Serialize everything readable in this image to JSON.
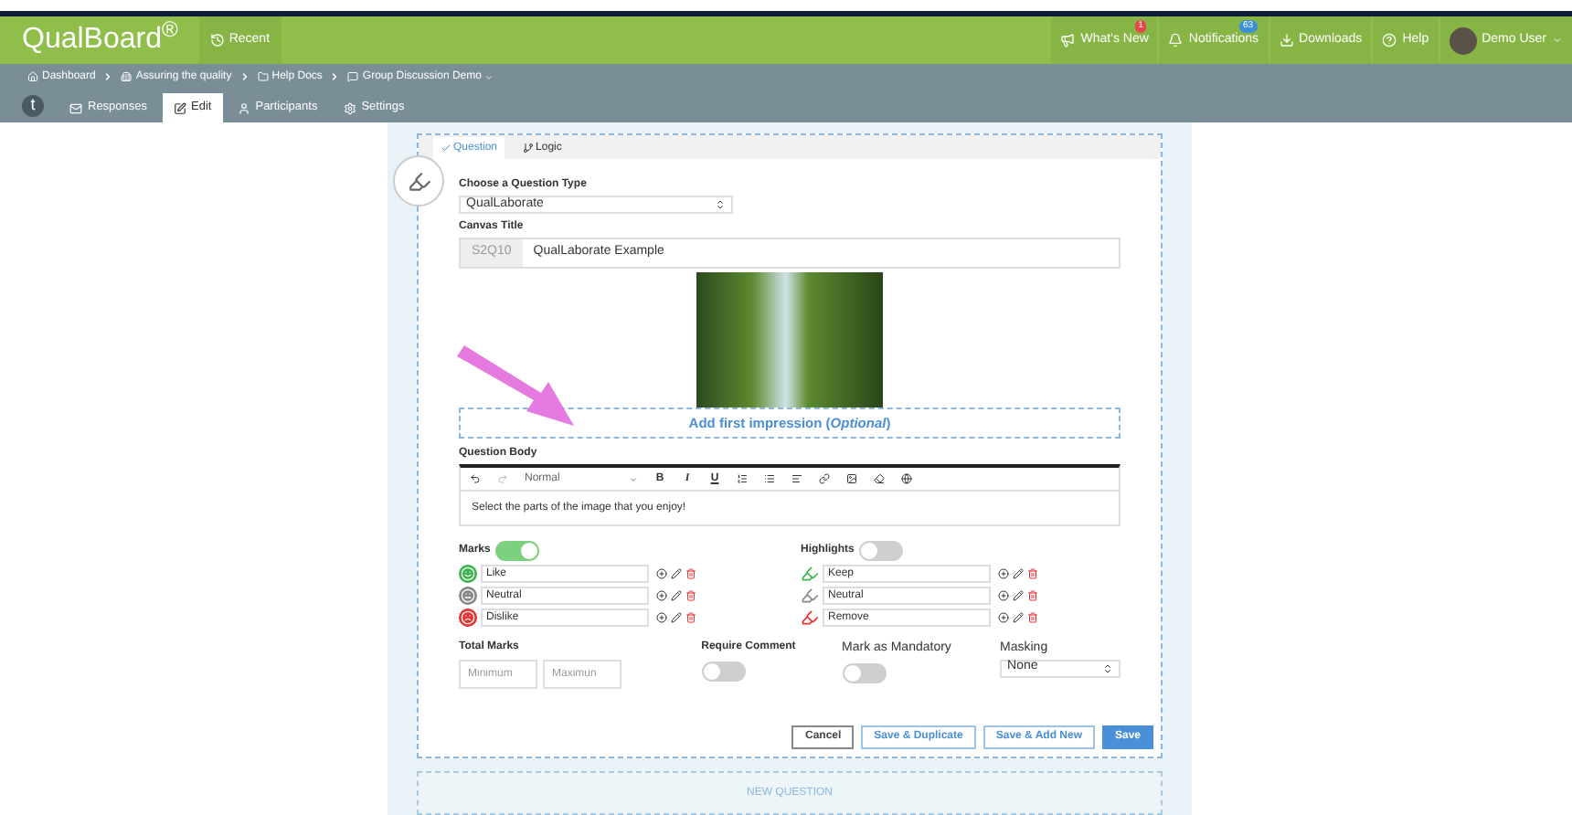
{
  "header": {
    "logo": "QualBoard$^{®}$",
    "recent": "Recent",
    "nav": [
      {
        "kind": "megaphone",
        "label": "What's New",
        "badge": "1",
        "color": "#e8474a"
      },
      {
        "kind": "bell",
        "label": "Notifications",
        "badge": "63",
        "color": "#3a8fd6"
      },
      {
        "kind": "download",
        "label": "Downloads"
      },
      {
        "kind": "help",
        "label": "Help"
      }
    ],
    "user": "Demo User"
  },
  "breadcrumbs": [
    {
      "kind": "home",
      "label": "Dashboard"
    },
    {
      "kind": "building",
      "label": "Assuring the quality"
    },
    {
      "kind": "folder",
      "label": "Help Docs"
    },
    {
      "kind": "chat",
      "label": "Group Discussion Demo"
    }
  ],
  "app_badge": "t",
  "tabs": [
    {
      "kind": "responses",
      "label": "Responses",
      "selected": false
    },
    {
      "kind": "edit",
      "label": "Edit",
      "selected": true
    },
    {
      "kind": "participants",
      "label": "Participants",
      "selected": false
    },
    {
      "kind": "settings",
      "label": "Settings",
      "selected": false
    }
  ],
  "editor": {
    "tabs": [
      {
        "kind": "question",
        "label": "Question",
        "selected": true
      },
      {
        "kind": "logic",
        "label": "Logic",
        "selected": false
      }
    ],
    "question_type": {
      "label": "Choose a Question Type",
      "value": "QualLaborate"
    },
    "canvas_title": {
      "label": "Canvas Title",
      "prefix": "S2Q10",
      "value": "QualLaborate Example"
    },
    "first_impression": "Add first impression (*Optional*)",
    "question_body": {
      "label": "Question Body",
      "format": "Normal",
      "text_buttons": [
        "B",
        "I",
        "U"
      ],
      "text": "Select the parts of the image that you enjoy!"
    },
    "marks": {
      "label": "Marks",
      "on": true,
      "items": [
        {
          "kind": "happy",
          "label": "Like",
          "color": "#3cb54a"
        },
        {
          "kind": "neutral",
          "label": "Neutral",
          "color": "#888888"
        },
        {
          "kind": "sad",
          "label": "Dislike",
          "color": "#e8322f"
        }
      ]
    },
    "highlights": {
      "label": "Highlights",
      "on": false,
      "items": [
        {
          "label": "Keep",
          "color": "#3cb54a"
        },
        {
          "label": "Neutral",
          "color": "#888888"
        },
        {
          "label": "Remove",
          "color": "#e8322f"
        }
      ]
    },
    "total_marks": {
      "label": "Total Marks",
      "min_placeholder": "Minimum",
      "max_placeholder": "Maximun"
    },
    "require_comment": {
      "label": "Require Comment",
      "on": false
    },
    "mandatory": {
      "label": "Mark as Mandatory",
      "on": false
    },
    "masking": {
      "label": "Masking",
      "value": "None"
    },
    "buttons": [
      {
        "kind": "cancel",
        "label": "Cancel"
      },
      {
        "kind": "outline",
        "label": "Save & Duplicate"
      },
      {
        "kind": "outline",
        "label": "Save & Add New"
      },
      {
        "kind": "primary",
        "label": "Save"
      }
    ]
  },
  "new_question": "NEW QUESTION"
}
